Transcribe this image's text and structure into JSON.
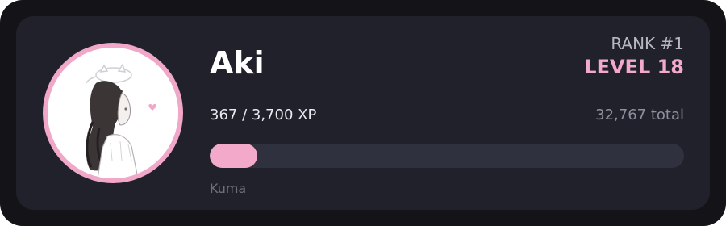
{
  "profile": {
    "username": "Aki",
    "avatar_icon": "anime-girl-with-cat-avatar",
    "footer": "Kuma"
  },
  "rank": {
    "label": "RANK #1",
    "level": "LEVEL 18"
  },
  "xp": {
    "progress_text": "367 / 3,700 XP",
    "total_text": "32,767 total",
    "current": 367,
    "max": 3700,
    "fill_fraction": 0.1
  },
  "colors": {
    "accent": "#f3a9c9",
    "card_bg": "#20212b",
    "outer_bg": "#141418",
    "bar_track": "#30313e"
  }
}
